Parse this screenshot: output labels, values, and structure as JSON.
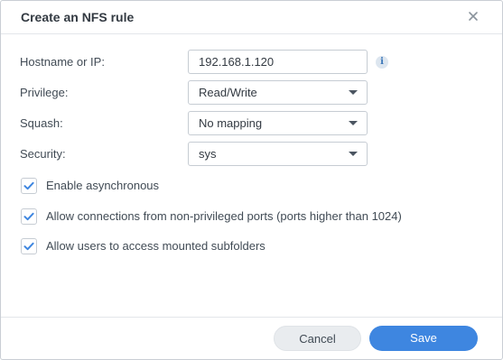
{
  "dialog": {
    "title": "Create an NFS rule",
    "close_icon": "close-icon"
  },
  "form": {
    "hostname": {
      "label": "Hostname or IP:",
      "value": "192.168.1.120",
      "info_icon": "info-icon"
    },
    "privilege": {
      "label": "Privilege:",
      "value": "Read/Write"
    },
    "squash": {
      "label": "Squash:",
      "value": "No mapping"
    },
    "security": {
      "label": "Security:",
      "value": "sys"
    }
  },
  "options": [
    {
      "label": "Enable asynchronous",
      "checked": true
    },
    {
      "label": "Allow connections from non-privileged ports (ports higher than 1024)",
      "checked": true
    },
    {
      "label": "Allow users to access mounted subfolders",
      "checked": true
    }
  ],
  "buttons": {
    "cancel": "Cancel",
    "save": "Save"
  },
  "colors": {
    "accent": "#3e86e0",
    "check": "#3e86e0"
  }
}
